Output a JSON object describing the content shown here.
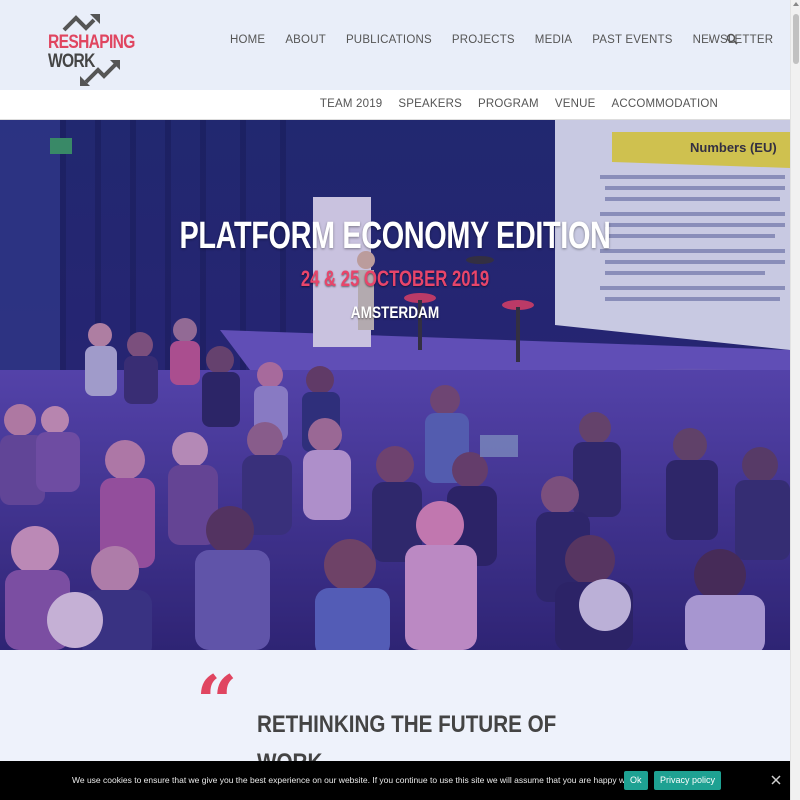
{
  "logo": {
    "line1": "RESHAPING",
    "line2": "WORK"
  },
  "nav": {
    "items": [
      "HOME",
      "ABOUT",
      "PUBLICATIONS",
      "PROJECTS",
      "MEDIA",
      "PAST EVENTS",
      "NEWSLETTER"
    ],
    "separator": "|",
    "search_icon": "search-icon"
  },
  "subnav": {
    "items": [
      "TEAM 2019",
      "SPEAKERS",
      "PROGRAM",
      "VENUE",
      "ACCOMMODATION"
    ]
  },
  "hero": {
    "title": "PLATFORM ECONOMY EDITION",
    "date": "24 & 25 OCTOBER 2019",
    "city": "AMSTERDAM",
    "slide_title": "Numbers (EU)"
  },
  "quote": {
    "mark": "“",
    "heading": "RETHINKING THE FUTURE OF WORK"
  },
  "cookie": {
    "text": "We use cookies to ensure that we give you the best experience on our website. If you continue to use this site we will assume that you are happy with it.",
    "ok_label": "Ok",
    "policy_label": "Privacy policy"
  },
  "colors": {
    "brand_pink": "#e04560",
    "cookie_button": "#1ea192",
    "header_bg": "#e9eef9"
  }
}
